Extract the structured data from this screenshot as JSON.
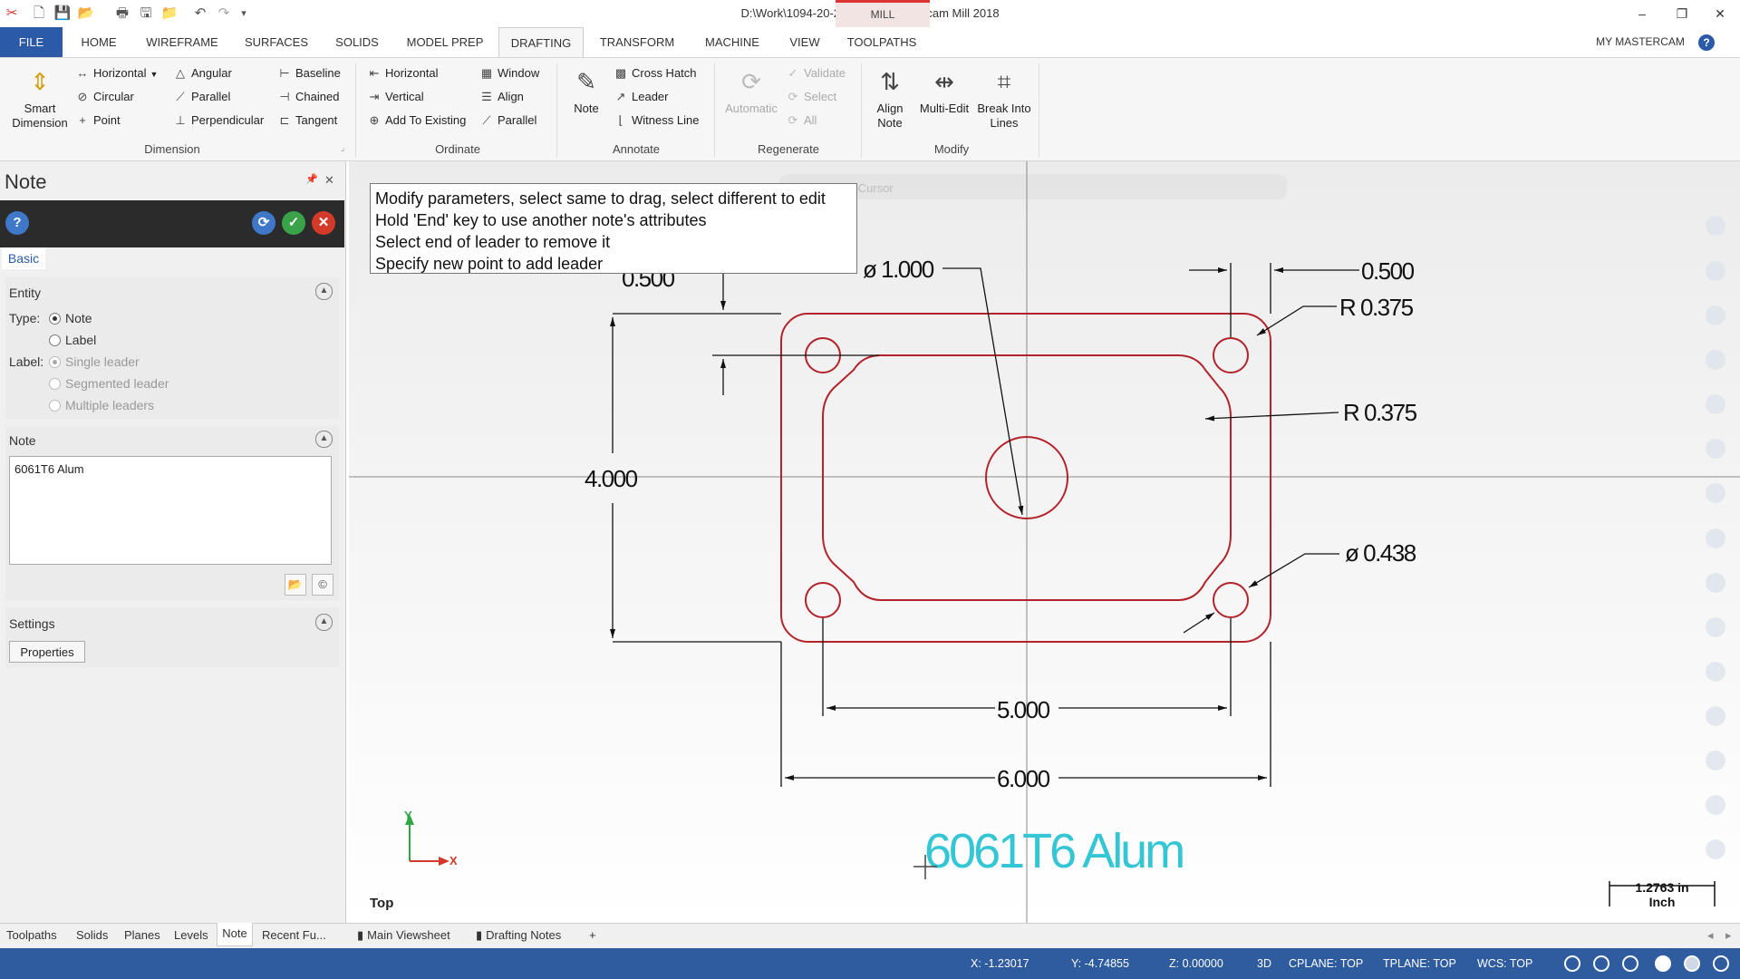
{
  "window": {
    "title": "D:\\Work\\1094-20-2.mcam* - Mastercam Mill 2018",
    "mode_tag": "MILL",
    "minimize": "–",
    "restore": "❐",
    "close": "✕"
  },
  "quick_access": [
    "✂",
    "🗋",
    "💾",
    "📂",
    "🖶",
    "🖫",
    "📁",
    "↶",
    "↷",
    "▾"
  ],
  "tabs": [
    "FILE",
    "HOME",
    "WIREFRAME",
    "SURFACES",
    "SOLIDS",
    "MODEL PREP",
    "DRAFTING",
    "TRANSFORM",
    "MACHINE",
    "VIEW",
    "TOOLPATHS"
  ],
  "my_mastercam": "MY MASTERCAM",
  "ribbon": {
    "dimension": {
      "smart_dimension": "Smart Dimension",
      "horizontal": "Horizontal",
      "angular": "Angular",
      "baseline": "Baseline",
      "circular": "Circular",
      "parallel": "Parallel",
      "chained": "Chained",
      "point": "Point",
      "perpendicular": "Perpendicular",
      "tangent": "Tangent",
      "group": "Dimension"
    },
    "ordinate": {
      "horizontal": "Horizontal",
      "window": "Window",
      "vertical": "Vertical",
      "align": "Align",
      "add_to_existing": "Add To Existing",
      "parallel": "Parallel",
      "group": "Ordinate"
    },
    "annotate": {
      "note": "Note",
      "cross_hatch": "Cross Hatch",
      "leader": "Leader",
      "witness_line": "Witness Line",
      "group": "Annotate"
    },
    "regenerate": {
      "automatic": "Automatic",
      "validate": "Validate",
      "select": "Select",
      "all": "All",
      "group": "Regenerate"
    },
    "modify": {
      "align_note": "Align Note",
      "multi_edit": "Multi-Edit",
      "break_into_lines": "Break Into Lines",
      "group": "Modify"
    }
  },
  "panel": {
    "title": "Note",
    "pin": "📌",
    "close": "✕",
    "help": "?",
    "basic_tab": "Basic",
    "entity": {
      "header": "Entity",
      "type_label": "Type:",
      "type_note": "Note",
      "type_label_opt": "Label",
      "label_label": "Label:",
      "single_leader": "Single leader",
      "segmented_leader": "Segmented leader",
      "multiple_leaders": "Multiple leaders"
    },
    "note": {
      "header": "Note",
      "text": "6061T6 Alum"
    },
    "settings": {
      "header": "Settings",
      "properties": "Properties"
    }
  },
  "tooltip": [
    "Modify parameters, select same to drag, select different to edit",
    "Hold 'End' key to use another note's attributes",
    "Select end of leader to remove it",
    "Specify new point to add leader"
  ],
  "drawing": {
    "dim_dia_center": "ø 1.000",
    "dim_top_left": "0.500",
    "dim_top_right": "0.500",
    "dim_r_outer": "R 0.375",
    "dim_r_inner": "R 0.375",
    "dim_height": "4.000",
    "dim_dia_hole": "ø 0.438",
    "dim_inner_width": "5.000",
    "dim_outer_width": "6.000",
    "note_text": "6061T6 Alum",
    "axis_y": "Y",
    "axis_x": "X",
    "view_name": "Top",
    "scale_value": "1.2763 in",
    "scale_unit": "Inch",
    "autocursor": "AutoCursor"
  },
  "bottom_tabs": [
    "Toolpaths",
    "Solids",
    "Planes",
    "Levels",
    "Note",
    "Recent Fu..."
  ],
  "viewsheets": [
    "Main Viewsheet",
    "Drafting Notes",
    "+"
  ],
  "status": {
    "x": "X:  -1.23017",
    "y": "Y:  -4.74855",
    "z": "Z:  0.00000",
    "mode": "3D",
    "cplane": "CPLANE: TOP",
    "tplane": "TPLANE: TOP",
    "wcs": "WCS: TOP"
  },
  "colors": {
    "accent": "#2a5aa8",
    "geometry": "#b3232b",
    "note": "#35c6d6",
    "status_bar": "#2f5c9e"
  }
}
